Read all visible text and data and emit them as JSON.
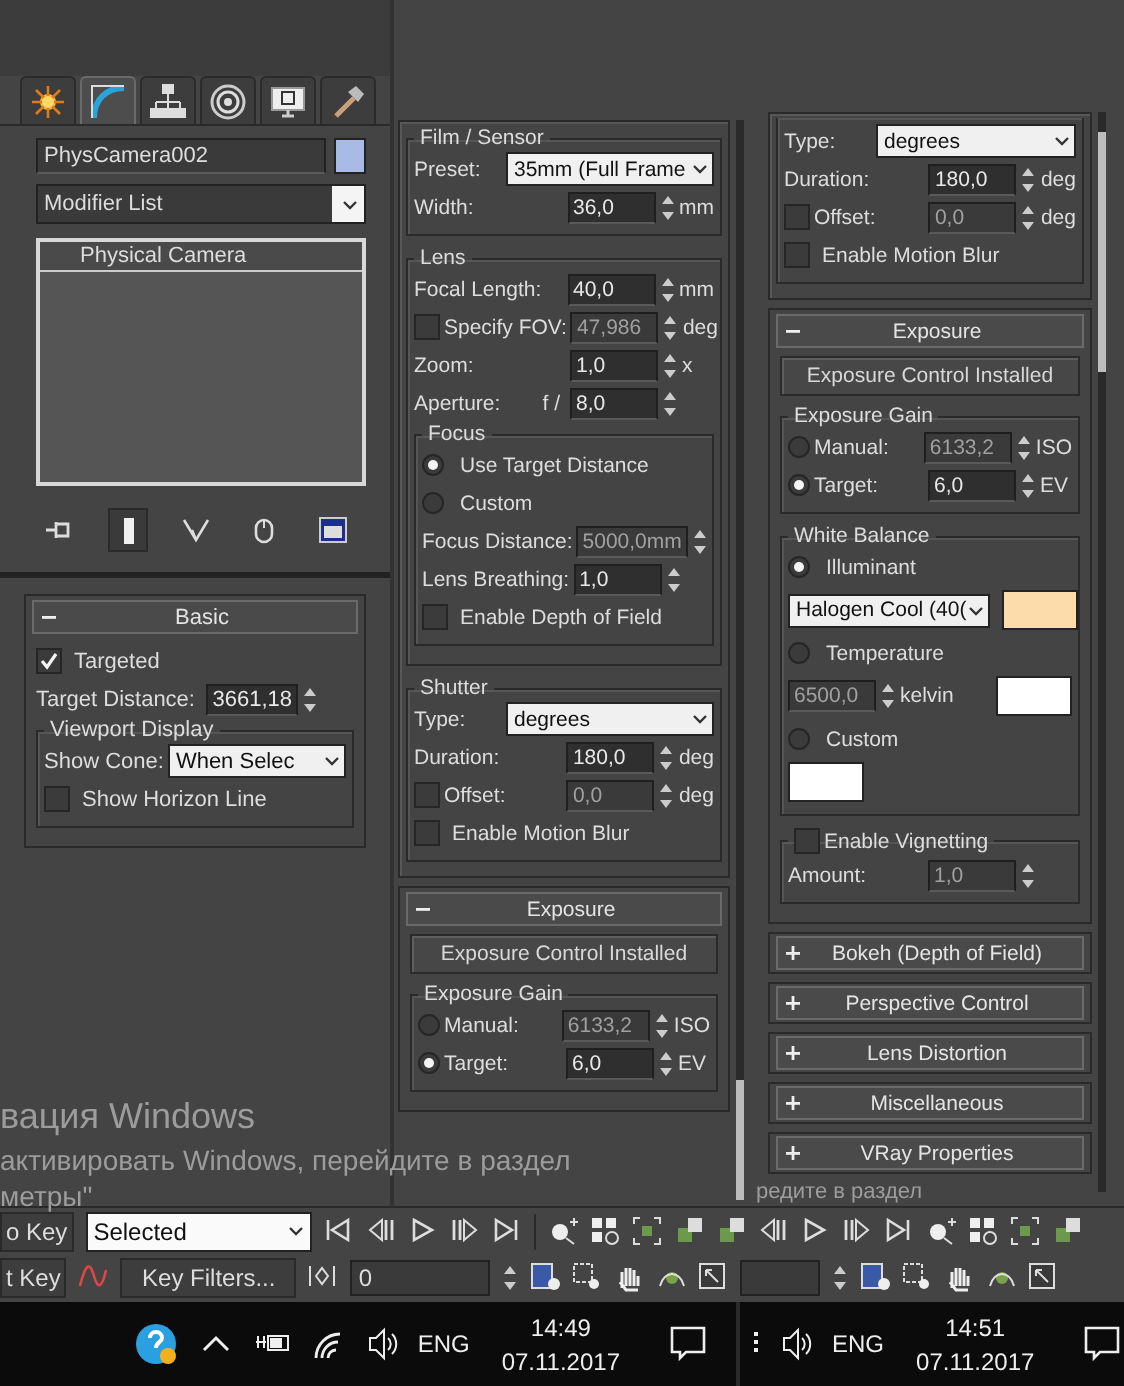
{
  "command_panel": {
    "tabs": [
      {
        "kind": "create",
        "selected": false
      },
      {
        "kind": "modify",
        "selected": true
      },
      {
        "kind": "hierarchy",
        "selected": false
      },
      {
        "kind": "motion",
        "selected": false
      },
      {
        "kind": "display",
        "selected": false
      },
      {
        "kind": "utilities",
        "selected": false
      }
    ],
    "object_name": "PhysCamera002",
    "object_swatch": {
      "color": "#a7bbe6"
    },
    "modifier_list": "Modifier List",
    "stack_items": [
      "Physical Camera"
    ],
    "rollouts": [
      {
        "kind": "rollout",
        "title": "Basic",
        "expanded": true,
        "items": [
          {
            "kind": "checkbox",
            "label": "Targeted",
            "checked": true
          },
          {
            "kind": "spinner",
            "label": "Target Distance:",
            "value": "3661,18",
            "disabled": false
          },
          {
            "kind": "group",
            "title": "Viewport Display",
            "items": [
              {
                "kind": "dropdown",
                "label": "Show Cone:",
                "value": "When Selec"
              },
              {
                "kind": "checkbox",
                "label": "Show Horizon Line",
                "checked": false
              }
            ]
          }
        ]
      }
    ]
  },
  "middle_panel": {
    "items": [
      {
        "kind": "body",
        "items": [
          {
            "kind": "group",
            "title": "Film / Sensor",
            "items": [
              {
                "kind": "dropdown",
                "label": "Preset:",
                "value": "35mm (Full Frame"
              },
              {
                "kind": "spinner",
                "label": "Width:",
                "value": "36,0",
                "unit": "mm",
                "disabled": false
              }
            ]
          },
          {
            "kind": "group",
            "title": "Lens",
            "items": [
              {
                "kind": "spinner",
                "label": "Focal Length:",
                "value": "40,0",
                "unit": "mm",
                "disabled": false
              },
              {
                "kind": "spinner",
                "label": "Specify FOV:",
                "value": "47,986",
                "unit": "deg",
                "checked": false,
                "disabled": true
              },
              {
                "kind": "spinner",
                "label": "Zoom:",
                "value": "1,0",
                "unit": "x",
                "disabled": false
              },
              {
                "kind": "spinner",
                "label": "Aperture:",
                "prefix": "f /",
                "value": "8,0",
                "disabled": false
              },
              {
                "kind": "group",
                "title": "Focus",
                "items": [
                  {
                    "kind": "radio",
                    "label": "Use Target Distance",
                    "selected": true
                  },
                  {
                    "kind": "radio",
                    "label": "Custom",
                    "selected": false
                  },
                  {
                    "kind": "spinner",
                    "label": "Focus Distance:",
                    "value": "5000,0mm",
                    "disabled": true
                  },
                  {
                    "kind": "spinner",
                    "label": "Lens Breathing:",
                    "value": "1,0",
                    "disabled": false
                  },
                  {
                    "kind": "checkbox",
                    "label": "Enable Depth of Field",
                    "checked": false
                  }
                ]
              }
            ]
          },
          {
            "kind": "group",
            "title": "Shutter",
            "items": [
              {
                "kind": "dropdown",
                "label": "Type:",
                "value": "degrees"
              },
              {
                "kind": "spinner",
                "label": "Duration:",
                "value": "180,0",
                "unit": "deg",
                "disabled": false
              },
              {
                "kind": "spinner",
                "label": "Offset:",
                "value": "0,0",
                "unit": "deg",
                "checked": false,
                "disabled": true
              },
              {
                "kind": "checkbox",
                "label": "Enable Motion Blur",
                "checked": false
              }
            ]
          }
        ]
      },
      {
        "kind": "rollout",
        "title": "Exposure",
        "expanded": true,
        "items": [
          {
            "kind": "button",
            "label": "Exposure Control Installed"
          },
          {
            "kind": "group",
            "title": "Exposure Gain",
            "items": [
              {
                "kind": "radio_spinner",
                "label": "Manual:",
                "value": "6133,2",
                "unit": "ISO",
                "selected": false,
                "disabled": true
              },
              {
                "kind": "radio_spinner",
                "label": "Target:",
                "value": "6,0",
                "unit": "EV",
                "selected": true,
                "disabled": false
              }
            ]
          }
        ]
      }
    ]
  },
  "right_panel": {
    "items": [
      {
        "kind": "body",
        "items": [
          {
            "kind": "group",
            "items": [
              {
                "kind": "dropdown",
                "label": "Type:",
                "value": "degrees"
              },
              {
                "kind": "spinner",
                "label": "Duration:",
                "value": "180,0",
                "unit": "deg",
                "disabled": false
              },
              {
                "kind": "spinner",
                "label": "Offset:",
                "value": "0,0",
                "unit": "deg",
                "checked": false,
                "disabled": true
              },
              {
                "kind": "checkbox",
                "label": "Enable Motion Blur",
                "checked": false
              }
            ]
          }
        ]
      },
      {
        "kind": "rollout",
        "title": "Exposure",
        "expanded": true,
        "items": [
          {
            "kind": "button",
            "label": "Exposure Control Installed"
          },
          {
            "kind": "group",
            "title": "Exposure Gain",
            "items": [
              {
                "kind": "radio_spinner",
                "label": "Manual:",
                "value": "6133,2",
                "unit": "ISO",
                "selected": false,
                "disabled": true
              },
              {
                "kind": "radio_spinner",
                "label": "Target:",
                "value": "6,0",
                "unit": "EV",
                "selected": true,
                "disabled": false
              }
            ]
          },
          {
            "kind": "group",
            "title": "White Balance",
            "items": [
              {
                "kind": "radio",
                "label": "Illuminant",
                "selected": true
              },
              {
                "kind": "row",
                "items": [
                  {
                    "kind": "dropdown",
                    "value": "Halogen Cool (40("
                  },
                  {
                    "kind": "swatch",
                    "color": "#fbdcaa"
                  }
                ]
              },
              {
                "kind": "radio",
                "label": "Temperature",
                "selected": false
              },
              {
                "kind": "row",
                "items": [
                  {
                    "kind": "spinner",
                    "value": "6500,0",
                    "unit": "kelvin",
                    "disabled": true
                  },
                  {
                    "kind": "swatch",
                    "color": "#ffffff"
                  }
                ]
              },
              {
                "kind": "radio",
                "label": "Custom",
                "selected": false
              },
              {
                "kind": "row",
                "items": [
                  {
                    "kind": "swatch",
                    "color": "#ffffff"
                  }
                ]
              }
            ]
          },
          {
            "kind": "group",
            "check": {
              "label": "Enable Vignetting",
              "checked": false
            },
            "items": [
              {
                "kind": "spinner",
                "label": "Amount:",
                "value": "1,0",
                "disabled": true
              }
            ]
          }
        ]
      },
      {
        "kind": "rollout",
        "title": "Bokeh (Depth of Field)",
        "expanded": false
      },
      {
        "kind": "rollout",
        "title": "Perspective Control",
        "expanded": false
      },
      {
        "kind": "rollout",
        "title": "Lens Distortion",
        "expanded": false
      },
      {
        "kind": "rollout",
        "title": "Miscellaneous",
        "expanded": false
      },
      {
        "kind": "rollout",
        "title": "VRay Properties",
        "expanded": false
      }
    ]
  },
  "activation_notice": [
    "вация Windows",
    "активировать Windows, перейдите в раздел",
    "метры\"",
    "редите в раздел"
  ],
  "timeline": {
    "auto_key": "o Key",
    "key_mode": "Selected",
    "set_key": "t Key",
    "key_filters": "Key Filters...",
    "frame": "0"
  },
  "taskbars": [
    {
      "language": "ENG",
      "time": "14:49",
      "date": "07.11.2017"
    },
    {
      "language": "ENG",
      "time": "14:51",
      "date": "07.11.2017"
    }
  ]
}
